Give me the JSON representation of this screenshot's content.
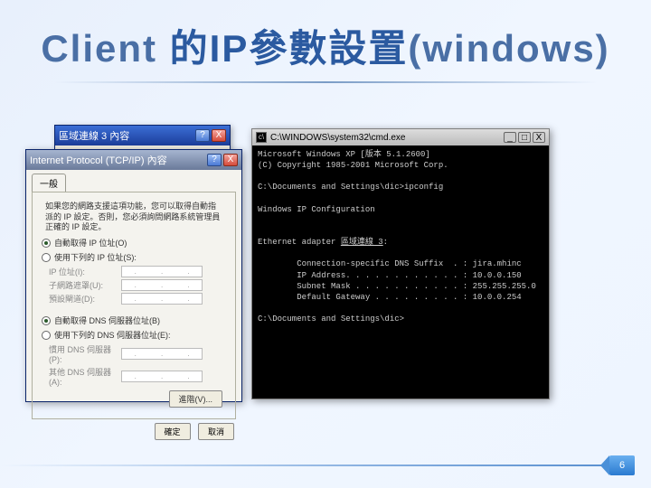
{
  "slide": {
    "title_pre": "Client ",
    "title_mid": "的IP參數設置",
    "title_post": "(windows)",
    "page_num": "6"
  },
  "win1": {
    "title": "區域連線 3 內容",
    "help": "?",
    "close": "X"
  },
  "win2": {
    "title": "Internet Protocol (TCP/IP) 內容",
    "help": "?",
    "close": "X",
    "tab": "一般",
    "desc": "如果您的網路支援這項功能，您可以取得自動指派的 IP 設定。否則，您必須詢問網路系統管理員正確的 IP 設定。",
    "r1": "自動取得 IP 位址(O)",
    "r2": "使用下列的 IP 位址(S):",
    "f_ip": "IP 位址(I):",
    "f_mask": "子網路遮罩(U):",
    "f_gw": "預設閘道(D):",
    "r3": "自動取得 DNS 伺服器位址(B)",
    "r4": "使用下列的 DNS 伺服器位址(E):",
    "f_dns1": "慣用 DNS 伺服器(P):",
    "f_dns2": "其他 DNS 伺服器(A):",
    "adv": "進階(V)...",
    "ok": "確定",
    "cancel": "取消"
  },
  "cmd": {
    "title": "C:\\WINDOWS\\system32\\cmd.exe",
    "min": "_",
    "max": "□",
    "close": "X",
    "l1": "Microsoft Windows XP [版本 5.1.2600]",
    "l2": "(C) Copyright 1985-2001 Microsoft Corp.",
    "l3": "C:\\Documents and Settings\\dic>ipconfig",
    "l4": "Windows IP Configuration",
    "l5a": "Ethernet adapter ",
    "l5b": "區域連線 3",
    "l5c": ":",
    "l6": "        Connection-specific DNS Suffix  . : jira.mhinc",
    "l7": "        IP Address. . . . . . . . . . . . : 10.0.0.150",
    "l8": "        Subnet Mask . . . . . . . . . . . : 255.255.255.0",
    "l9": "        Default Gateway . . . . . . . . . : 10.0.0.254",
    "l10": "C:\\Documents and Settings\\dic>"
  }
}
